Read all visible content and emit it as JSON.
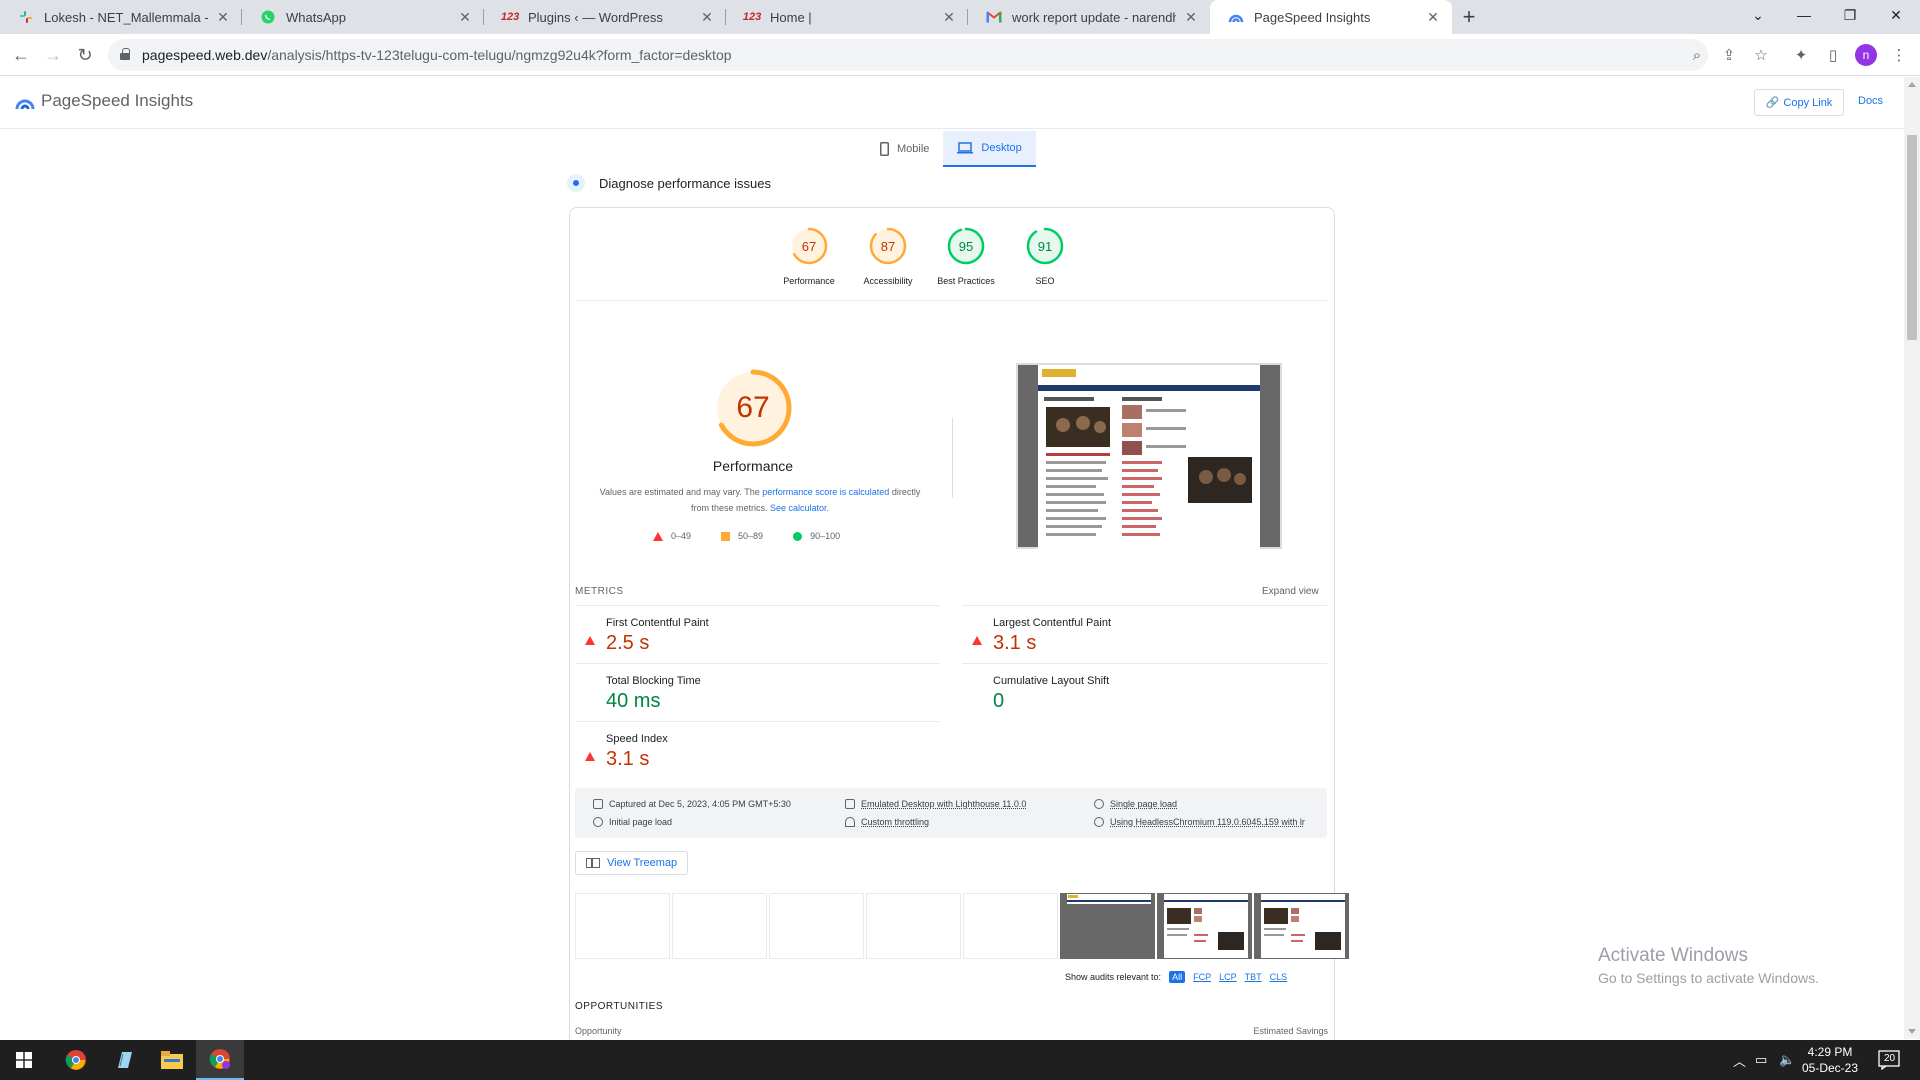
{
  "browser": {
    "tabs": [
      {
        "title": "Lokesh - NET_Mallemmala - Slac",
        "icon": "slack-icon",
        "active": false
      },
      {
        "title": "WhatsApp",
        "icon": "whatsapp-icon",
        "active": false
      },
      {
        "title": "Plugins ‹ — WordPress",
        "icon": "site-123-icon",
        "active": false
      },
      {
        "title": "Home |",
        "icon": "site-123-icon",
        "active": false
      },
      {
        "title": "work report update - narendhar",
        "icon": "gmail-icon",
        "active": false
      },
      {
        "title": "PageSpeed Insights",
        "icon": "pagespeed-icon",
        "active": true
      }
    ],
    "url_host": "pagespeed.web.dev",
    "url_path": "/analysis/https-tv-123telugu-com-telugu/ngmzg92u4k?form_factor=desktop",
    "profile_initial": "n",
    "fav_123": "123"
  },
  "psi": {
    "title": "PageSpeed Insights",
    "copy_link": "Copy Link",
    "docs": "Docs",
    "device_tabs": {
      "mobile": "Mobile",
      "desktop": "Desktop"
    },
    "diagnose": "Diagnose performance issues",
    "scores": [
      {
        "label": "Performance",
        "value": "67",
        "color": "#fa3"
      },
      {
        "label": "Accessibility",
        "value": "87",
        "color": "#fa3"
      },
      {
        "label": "Best Practices",
        "value": "95",
        "color": "#0c6"
      },
      {
        "label": "SEO",
        "value": "91",
        "color": "#0c6"
      }
    ],
    "big_score": {
      "value": "67",
      "label": "Performance"
    },
    "note": {
      "part1": "Values are estimated and may vary. The ",
      "link1": "performance score is calculated",
      "part2": " directly from these metrics. ",
      "link2": "See calculator."
    },
    "legend": {
      "fail": "0–49",
      "average": "50–89",
      "pass": "90–100"
    },
    "metrics_header": "METRICS",
    "expand_view": "Expand view",
    "metrics": {
      "fcp": {
        "name": "First Contentful Paint",
        "value": "2.5 s",
        "status": "fail"
      },
      "lcp": {
        "name": "Largest Contentful Paint",
        "value": "3.1 s",
        "status": "fail"
      },
      "tbt": {
        "name": "Total Blocking Time",
        "value": "40 ms",
        "status": "pass"
      },
      "cls": {
        "name": "Cumulative Layout Shift",
        "value": "0",
        "status": "pass"
      },
      "si": {
        "name": "Speed Index",
        "value": "3.1 s",
        "status": "fail"
      }
    },
    "runinfo": {
      "captured": "Captured at Dec 5, 2023, 4:05 PM GMT+5:30",
      "emulated": "Emulated Desktop with Lighthouse 11.0.0",
      "single": "Single page load",
      "initial": "Initial page load",
      "throttling": "Custom throttling",
      "browser": "Using HeadlessChromium 119.0.6045.159 with lr"
    },
    "view_treemap": "View Treemap",
    "show_audits": "Show audits relevant to:",
    "audit_filters": [
      "All",
      "FCP",
      "LCP",
      "TBT",
      "CLS"
    ],
    "opportunities": "OPPORTUNITIES",
    "opportunity_col": "Opportunity",
    "savings_col": "Estimated Savings"
  },
  "watermark": {
    "line1": "Activate Windows",
    "line2": "Go to Settings to activate Windows."
  },
  "taskbar": {
    "time": "4:29 PM",
    "date": "05-Dec-23",
    "notifications": "20"
  }
}
